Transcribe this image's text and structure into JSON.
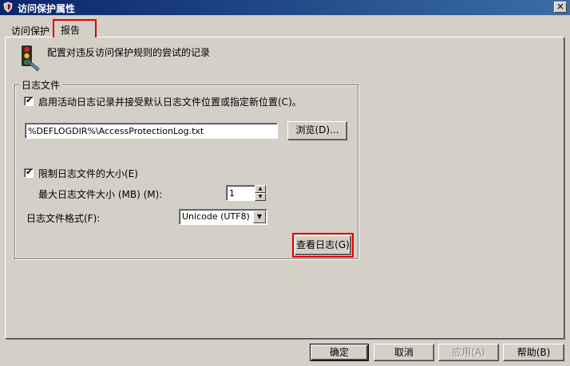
{
  "window": {
    "title": "访问保护属性",
    "close_symbol": "✕"
  },
  "tabs": [
    {
      "label": "访问保护"
    },
    {
      "label": "报告"
    }
  ],
  "description": "配置对违反访问保护规则的尝试的记录",
  "logfile_group": {
    "label": "日志文件",
    "enable_logging_label": "启用活动日志记录并接受默认日志文件位置或指定新位置(C)。",
    "enable_logging_checked": true,
    "path_value": "%DEFLOGDIR%\\AccessProtectionLog.txt",
    "browse_label": "浏览(D)...",
    "limit_size_label": "限制日志文件的大小(E)",
    "limit_size_checked": true,
    "max_size_label": "最大日志文件大小 (MB) (M):",
    "max_size_value": "1",
    "format_label": "日志文件格式(F):",
    "format_value": "Unicode (UTF8)",
    "view_log_label": "查看日志(G)"
  },
  "footer": {
    "ok_label": "确定",
    "cancel_label": "取消",
    "apply_label": "应用(A)",
    "help_label": "帮助(B)"
  }
}
